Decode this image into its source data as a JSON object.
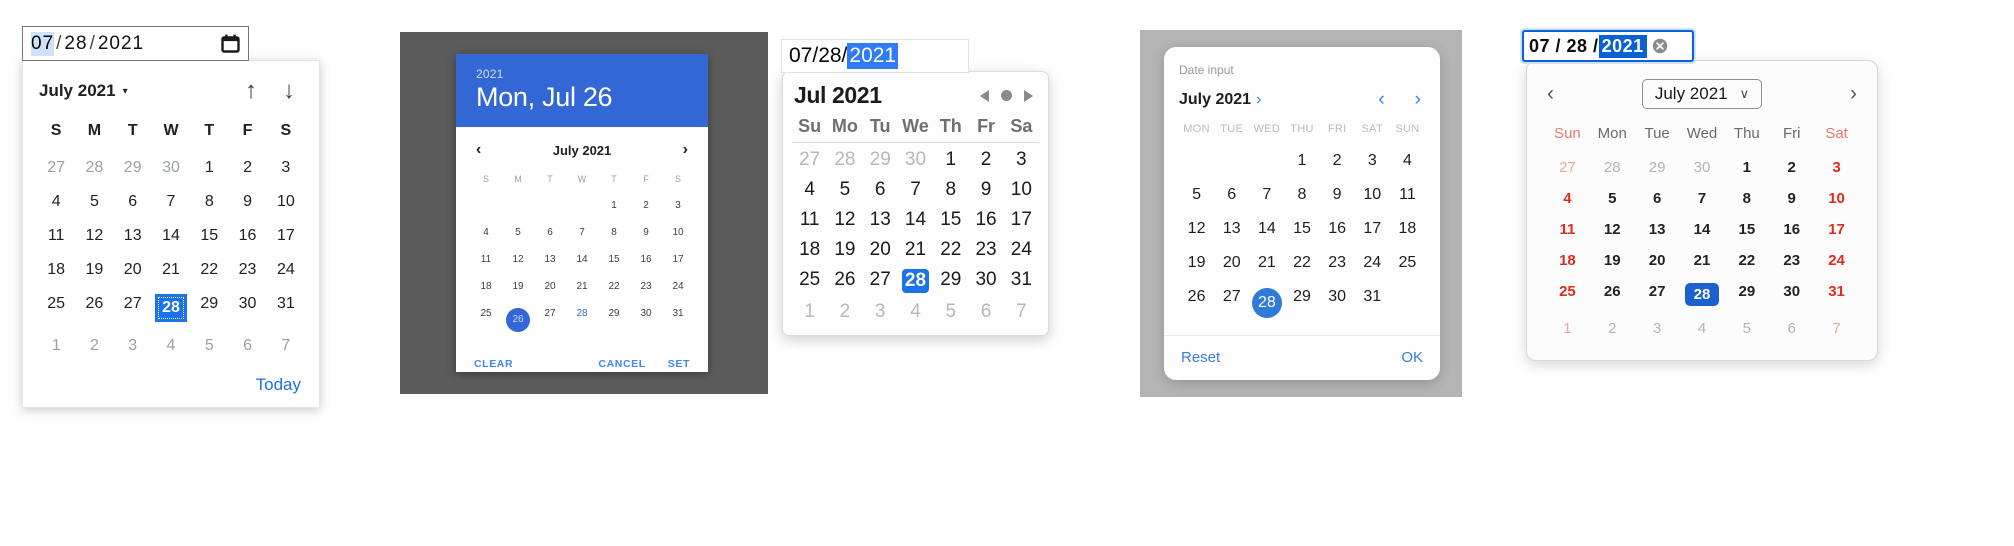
{
  "picker1": {
    "name": "chrome-desktop-date-picker",
    "input": {
      "month": "07",
      "day": "28",
      "year": "2021",
      "slash": "/",
      "icon": "calendar-icon"
    },
    "header": {
      "title": "July 2021",
      "caret": "▾",
      "prev_icon": "↑",
      "next_icon": "↓"
    },
    "dow": [
      "S",
      "M",
      "T",
      "W",
      "T",
      "F",
      "S"
    ],
    "weeks": [
      [
        "27",
        "28",
        "29",
        "30",
        "1",
        "2",
        "3"
      ],
      [
        "4",
        "5",
        "6",
        "7",
        "8",
        "9",
        "10"
      ],
      [
        "11",
        "12",
        "13",
        "14",
        "15",
        "16",
        "17"
      ],
      [
        "18",
        "19",
        "20",
        "21",
        "22",
        "23",
        "24"
      ],
      [
        "25",
        "26",
        "27",
        "28",
        "29",
        "30",
        "31"
      ],
      [
        "1",
        "2",
        "3",
        "4",
        "5",
        "6",
        "7"
      ]
    ],
    "muted": [
      [
        0,
        0
      ],
      [
        0,
        1
      ],
      [
        0,
        2
      ],
      [
        0,
        3
      ],
      [
        5,
        0
      ],
      [
        5,
        1
      ],
      [
        5,
        2
      ],
      [
        5,
        3
      ],
      [
        5,
        4
      ],
      [
        5,
        5
      ],
      [
        5,
        6
      ]
    ],
    "selected": [
      4,
      3
    ],
    "footer": {
      "today_label": "Today"
    },
    "accent": "#1a73e8"
  },
  "picker2": {
    "name": "material-date-picker-dialog",
    "header": {
      "year": "2021",
      "date": "Mon, Jul 26"
    },
    "month_nav": {
      "prev": "‹",
      "label": "July 2021",
      "next": "›"
    },
    "dow": [
      "S",
      "M",
      "T",
      "W",
      "T",
      "F",
      "S"
    ],
    "weeks": [
      [
        "",
        "",
        "",
        "",
        "1",
        "2",
        "3"
      ],
      [
        "4",
        "5",
        "6",
        "7",
        "8",
        "9",
        "10"
      ],
      [
        "11",
        "12",
        "13",
        "14",
        "15",
        "16",
        "17"
      ],
      [
        "18",
        "19",
        "20",
        "21",
        "22",
        "23",
        "24"
      ],
      [
        "25",
        "26",
        "27",
        "28",
        "29",
        "30",
        "31"
      ]
    ],
    "selected": [
      4,
      1
    ],
    "today": [
      4,
      3
    ],
    "actions": {
      "clear": "CLEAR",
      "cancel": "CANCEL",
      "set": "SET"
    },
    "accent": "#3367d6",
    "scrim": "#5c5c5c"
  },
  "picker3": {
    "name": "macos-safari-date-picker",
    "input": {
      "text": "07/28/",
      "highlight": "2021"
    },
    "header": {
      "title": "Jul 2021",
      "prev_icon": "triangle-left-icon",
      "dot_icon": "circle-dot-icon",
      "next_icon": "triangle-right-icon"
    },
    "dow": [
      "Su",
      "Mo",
      "Tu",
      "We",
      "Th",
      "Fr",
      "Sa"
    ],
    "weeks": [
      [
        "27",
        "28",
        "29",
        "30",
        "1",
        "2",
        "3"
      ],
      [
        "4",
        "5",
        "6",
        "7",
        "8",
        "9",
        "10"
      ],
      [
        "11",
        "12",
        "13",
        "14",
        "15",
        "16",
        "17"
      ],
      [
        "18",
        "19",
        "20",
        "21",
        "22",
        "23",
        "24"
      ],
      [
        "25",
        "26",
        "27",
        "28",
        "29",
        "30",
        "31"
      ],
      [
        "1",
        "2",
        "3",
        "4",
        "5",
        "6",
        "7"
      ]
    ],
    "muted": [
      [
        0,
        0
      ],
      [
        0,
        1
      ],
      [
        0,
        2
      ],
      [
        0,
        3
      ],
      [
        5,
        0
      ],
      [
        5,
        1
      ],
      [
        5,
        2
      ],
      [
        5,
        3
      ],
      [
        5,
        4
      ],
      [
        5,
        5
      ],
      [
        5,
        6
      ]
    ],
    "selected": [
      4,
      3
    ],
    "accent": "#1a73e8"
  },
  "picker4": {
    "name": "mobile-date-input-dialog",
    "label": "Date input",
    "month": "July 2021",
    "month_chevron": "›",
    "prev_icon": "‹",
    "next_icon": "›",
    "dow": [
      "MON",
      "TUE",
      "WED",
      "THU",
      "FRI",
      "SAT",
      "SUN"
    ],
    "weeks": [
      [
        "",
        "",
        "",
        "1",
        "2",
        "3",
        "4"
      ],
      [
        "5",
        "6",
        "7",
        "8",
        "9",
        "10",
        "11"
      ],
      [
        "12",
        "13",
        "14",
        "15",
        "16",
        "17",
        "18"
      ],
      [
        "19",
        "20",
        "21",
        "22",
        "23",
        "24",
        "25"
      ],
      [
        "26",
        "27",
        "28",
        "29",
        "30",
        "31",
        ""
      ]
    ],
    "selected": [
      4,
      2
    ],
    "actions": {
      "reset": "Reset",
      "ok": "OK"
    },
    "accent": "#2f7cd8",
    "scrim": "#b4b4b4"
  },
  "picker5": {
    "name": "firefox-desktop-date-picker",
    "input": {
      "text": "07 / 28 / ",
      "highlight": "2021",
      "clear_icon": "clear-circle-icon"
    },
    "header": {
      "prev_icon": "‹",
      "month_label": "July 2021",
      "dropdown_icon": "∨",
      "next_icon": "›"
    },
    "dow": [
      "Sun",
      "Mon",
      "Tue",
      "Wed",
      "Thu",
      "Fri",
      "Sat"
    ],
    "weeks": [
      [
        "27",
        "28",
        "29",
        "30",
        "1",
        "2",
        "3"
      ],
      [
        "4",
        "5",
        "6",
        "7",
        "8",
        "9",
        "10"
      ],
      [
        "11",
        "12",
        "13",
        "14",
        "15",
        "16",
        "17"
      ],
      [
        "18",
        "19",
        "20",
        "21",
        "22",
        "23",
        "24"
      ],
      [
        "25",
        "26",
        "27",
        "28",
        "29",
        "30",
        "31"
      ],
      [
        "1",
        "2",
        "3",
        "4",
        "5",
        "6",
        "7"
      ]
    ],
    "muted": [
      [
        0,
        0
      ],
      [
        0,
        1
      ],
      [
        0,
        2
      ],
      [
        0,
        3
      ],
      [
        5,
        0
      ],
      [
        5,
        1
      ],
      [
        5,
        2
      ],
      [
        5,
        3
      ],
      [
        5,
        4
      ],
      [
        5,
        5
      ],
      [
        5,
        6
      ]
    ],
    "selected": [
      4,
      3
    ],
    "weekend_cols": [
      0,
      6
    ],
    "accent": "#1a62d0",
    "weekend_color": "#e02b1e"
  }
}
